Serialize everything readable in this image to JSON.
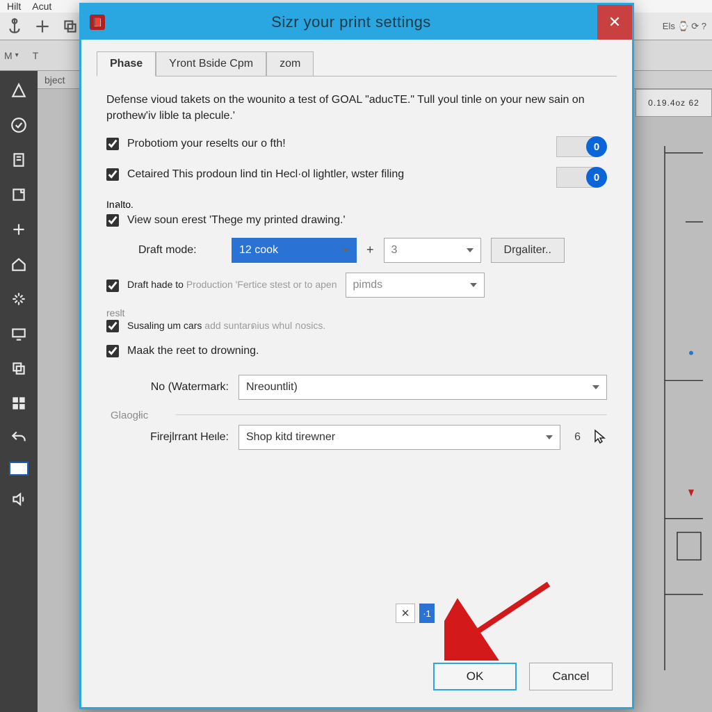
{
  "bg": {
    "menu": {
      "hilt": "Hilt",
      "acut": "Acut"
    },
    "row2": {
      "m": "M",
      "t": "T",
      "object": "bject"
    },
    "right_status": "0.19.4oz 62",
    "right_icons": "Els  ⌚  ⟳  ?"
  },
  "dialog": {
    "title": "Sizr your print settings",
    "close": "✕",
    "tabs": [
      "Phase",
      "Yront Bside Cpm",
      "zom"
    ],
    "intro": "Defense vioud takets on the wounito a test of GOAL \"aducTE.\" Tull youl tinle on your new sain on prothew'iv lible ta plecule.'",
    "chk1": "Probotiom your reselts our o fth!",
    "chk2": "Cetaired This prodoun lind tin Hecl·ol lightler, wster filing",
    "chk2_sub": "Inลlto.",
    "chk3": "View soun erest 'Thege my printed drawing.'",
    "draft_mode_label": "Draft mode:",
    "draft_mode_value": "12 cook",
    "plus": "+",
    "draft_mode_value2": "3",
    "digaliter_btn": "Drgaliter..",
    "chk4_pre": "Draft hade to ",
    "chk4_mid": "Production 'Fertice stest or to apen",
    "chk4_combo": "pimds",
    "chk4_sub": "reslt",
    "chk5_pre": "Susaling um cars ",
    "chk5_mid": "add suntarดius whul กosics.",
    "chk6": "Maak the reet to drowning.",
    "watermark_label": "No (Watermark:",
    "watermark_value": "Nreountlit)",
    "section_gio": "Glaogłic",
    "fire_label": "Firejlrrant Heιle:",
    "fire_value": "Shop kitd tirewner",
    "fire_after": "6",
    "small_x": "✕",
    "small_dot": "·1",
    "badge0a": "0",
    "badge0b": "0",
    "ok": "OK",
    "cancel": "Cancel"
  }
}
